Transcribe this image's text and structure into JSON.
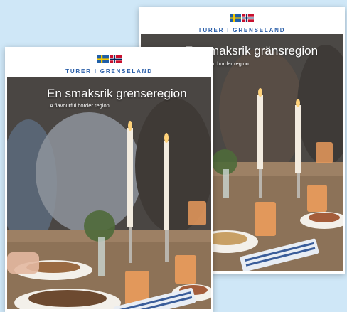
{
  "brand": {
    "name": "TURER I GRENSELAND",
    "color": "#2a5ea8"
  },
  "back_cover": {
    "headline": "En smaksrik gränsregion",
    "subline": "A flavourful border region",
    "language_flags": [
      "swedish-flag",
      "uk-flag"
    ]
  },
  "front_cover": {
    "headline": "En smaksrik grenseregion",
    "subline": "A flavourful border region",
    "language_flags": [
      "norwegian-flag",
      "uk-flag"
    ]
  },
  "colors": {
    "background": "#cfe7f7",
    "sweden_blue": "#1f5fa8",
    "sweden_yellow": "#f6c800",
    "norway_red": "#c8102e",
    "norway_blue": "#00205b"
  }
}
